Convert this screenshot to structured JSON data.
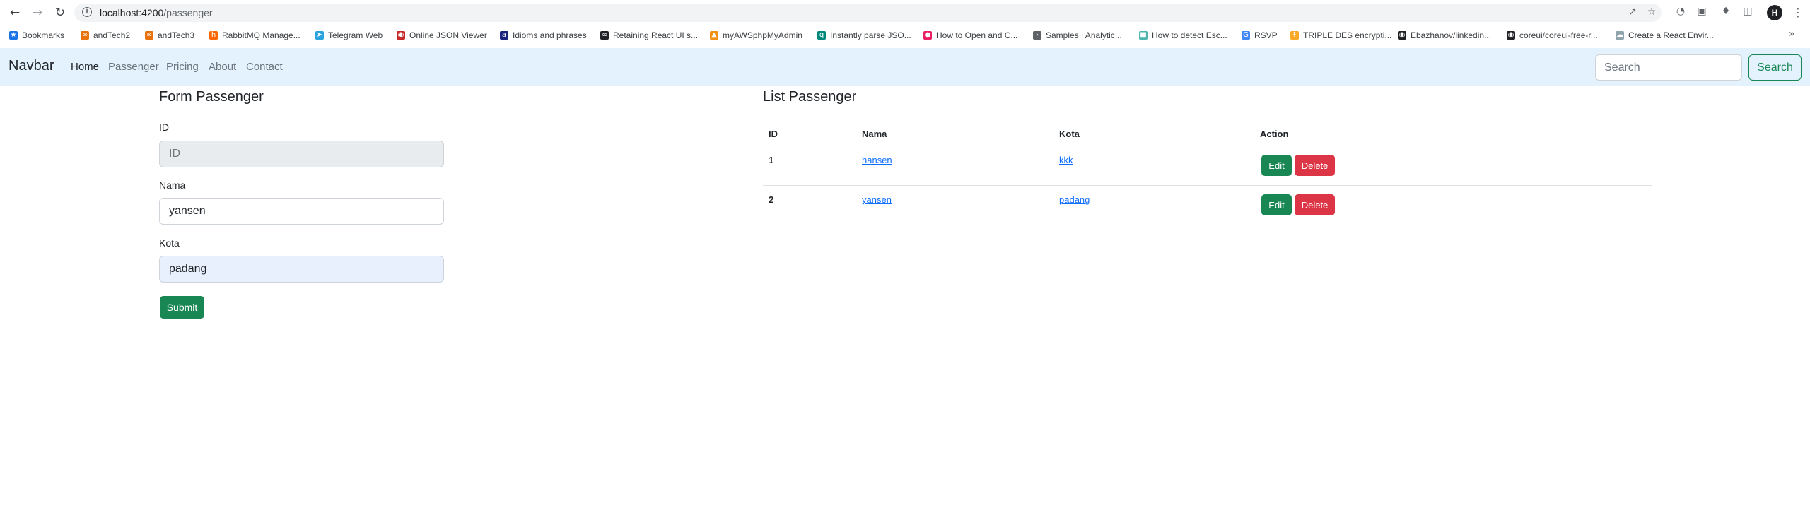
{
  "browser": {
    "url_host": "localhost:4200",
    "url_path": "/passenger",
    "avatar_letter": "H",
    "bookmarks": [
      {
        "label": "Bookmarks",
        "icon": "star-icon",
        "color": "#1a73e8"
      },
      {
        "label": "andTech2",
        "icon": "andtech-icon",
        "color": "#e8710a"
      },
      {
        "label": "andTech3",
        "icon": "andtech-icon",
        "color": "#e8710a"
      },
      {
        "label": "RabbitMQ Manage...",
        "icon": "rabbitmq-icon",
        "color": "#ff6600"
      },
      {
        "label": "Telegram Web",
        "icon": "telegram-icon",
        "color": "#2aa3df"
      },
      {
        "label": "Online JSON Viewer",
        "icon": "json-viewer-icon",
        "color": "#c62828"
      },
      {
        "label": "Idioms and phrases",
        "icon": "idioms-icon",
        "color": "#1a237e"
      },
      {
        "label": "Retaining React UI s...",
        "icon": "infinity-icon",
        "color": "#202124"
      },
      {
        "label": "myAWSphpMyAdmin",
        "icon": "phpmyadmin-icon",
        "color": "#f29111"
      },
      {
        "label": "Instantly parse JSO...",
        "icon": "quicktype-icon",
        "color": "#00897b"
      },
      {
        "label": "How to Open and C...",
        "icon": "circle-red-icon",
        "color": "#e91e63"
      },
      {
        "label": "Samples | Analytic...",
        "icon": "analytics-icon",
        "color": "#5f6368"
      },
      {
        "label": "How to detect Esc...",
        "icon": "green-square-icon",
        "color": "#4db6ac"
      },
      {
        "label": "RSVP",
        "icon": "google-icon",
        "color": "#4285f4"
      },
      {
        "label": "TRIPLE DES encrypti...",
        "icon": "tripledes-icon",
        "color": "#f9a825"
      },
      {
        "label": "Ebazhanov/linkedin...",
        "icon": "github-icon",
        "color": "#202124"
      },
      {
        "label": "coreui/coreui-free-r...",
        "icon": "github-icon",
        "color": "#202124"
      },
      {
        "label": "Create a React Envir...",
        "icon": "cloud-icon",
        "color": "#90a4ae"
      }
    ]
  },
  "navbar": {
    "brand": "Navbar",
    "links": [
      "Home",
      "Passenger",
      "Pricing",
      "About",
      "Contact"
    ],
    "active": "Home",
    "search_placeholder": "Search",
    "search_button": "Search"
  },
  "form": {
    "title": "Form Passenger",
    "id_label": "ID",
    "id_placeholder": "ID",
    "nama_label": "Nama",
    "nama_value": "yansen",
    "kota_label": "Kota",
    "kota_value": "padang",
    "submit_label": "Submit"
  },
  "list": {
    "title": "List Passenger",
    "headers": {
      "id": "ID",
      "nama": "Nama",
      "kota": "Kota",
      "action": "Action"
    },
    "rows": [
      {
        "id": "1",
        "nama": "hansen",
        "kota": "kkk",
        "edit": "Edit",
        "delete": "Delete"
      },
      {
        "id": "2",
        "nama": "yansen",
        "kota": "padang",
        "edit": "Edit",
        "delete": "Delete"
      }
    ]
  },
  "colors": {
    "navbar_bg": "#e3f2fd",
    "success": "#198754",
    "danger": "#dc3545",
    "link": "#0d6efd"
  }
}
